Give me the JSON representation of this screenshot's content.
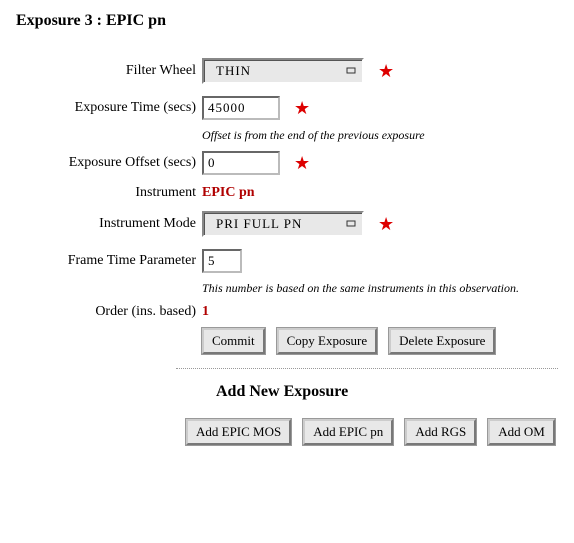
{
  "heading": "Exposure 3 : EPIC pn",
  "labels": {
    "filter_wheel": "Filter Wheel",
    "exposure_time": "Exposure Time (secs)",
    "exposure_offset": "Exposure Offset (secs)",
    "instrument": "Instrument",
    "instrument_mode": "Instrument Mode",
    "frame_time": "Frame Time Parameter",
    "order": "Order (ins. based)"
  },
  "values": {
    "filter_wheel": "THIN",
    "exposure_time": "45000",
    "exposure_offset": "0",
    "instrument": "EPIC pn",
    "instrument_mode": "PRI FULL PN",
    "frame_time": "5",
    "order": "1"
  },
  "notes": {
    "offset": "Offset is from the end of the previous exposure",
    "frame": "This number is based on the same instruments in this observation."
  },
  "buttons": {
    "commit": "Commit",
    "copy": "Copy Exposure",
    "delete": "Delete Exposure"
  },
  "add_section": {
    "heading": "Add New Exposure",
    "mos": "Add EPIC MOS",
    "pn": "Add EPIC pn",
    "rgs": "Add RGS",
    "om": "Add OM"
  }
}
